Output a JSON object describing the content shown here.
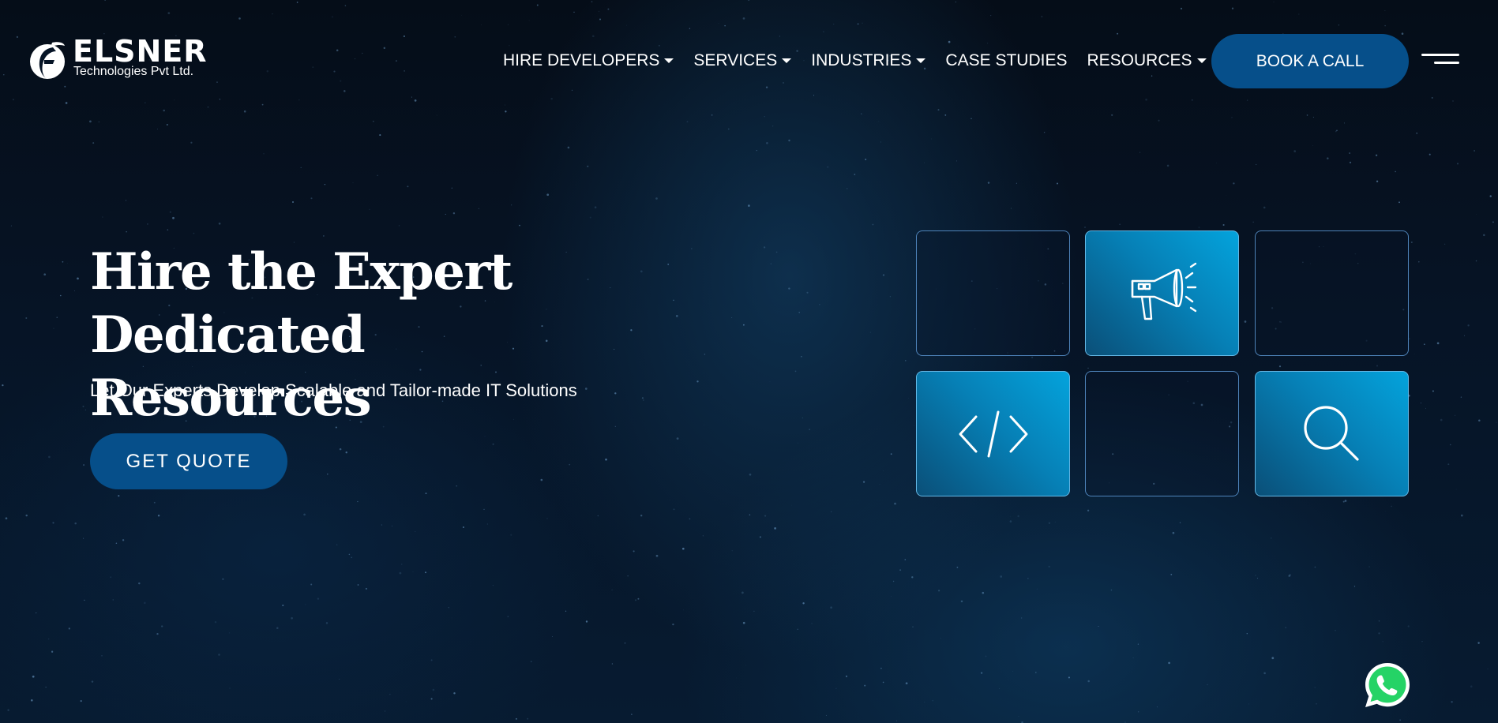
{
  "brand": {
    "name": "ELSNER",
    "tagline": "Technologies Pvt Ltd."
  },
  "nav": {
    "items": [
      {
        "label": "HIRE DEVELOPERS",
        "dropdown": true
      },
      {
        "label": "SERVICES",
        "dropdown": true
      },
      {
        "label": "INDUSTRIES",
        "dropdown": true
      },
      {
        "label": "CASE STUDIES",
        "dropdown": false
      },
      {
        "label": "RESOURCES",
        "dropdown": true
      }
    ],
    "cta_label": "BOOK A CALL",
    "menu_icon": "hamburger-icon"
  },
  "hero": {
    "title_line1": "Hire the Expert Dedicated",
    "title_line2": "Resources",
    "subtitle": "Let Our Experts Develop Scalable and Tailor-made IT Solutions",
    "cta_label": "GET QUOTE"
  },
  "tiles": [
    {
      "filled": false,
      "icon": ""
    },
    {
      "filled": true,
      "icon": "megaphone-icon"
    },
    {
      "filled": false,
      "icon": ""
    },
    {
      "filled": true,
      "icon": "code-icon"
    },
    {
      "filled": false,
      "icon": ""
    },
    {
      "filled": true,
      "icon": "search-icon"
    }
  ],
  "floating": {
    "icon": "whatsapp-icon"
  },
  "colors": {
    "background": "#061426",
    "button": "#064f8a",
    "tile_accent": "#04a3dc",
    "tile_border": "#5a96d2",
    "whatsapp": "#25d366"
  }
}
